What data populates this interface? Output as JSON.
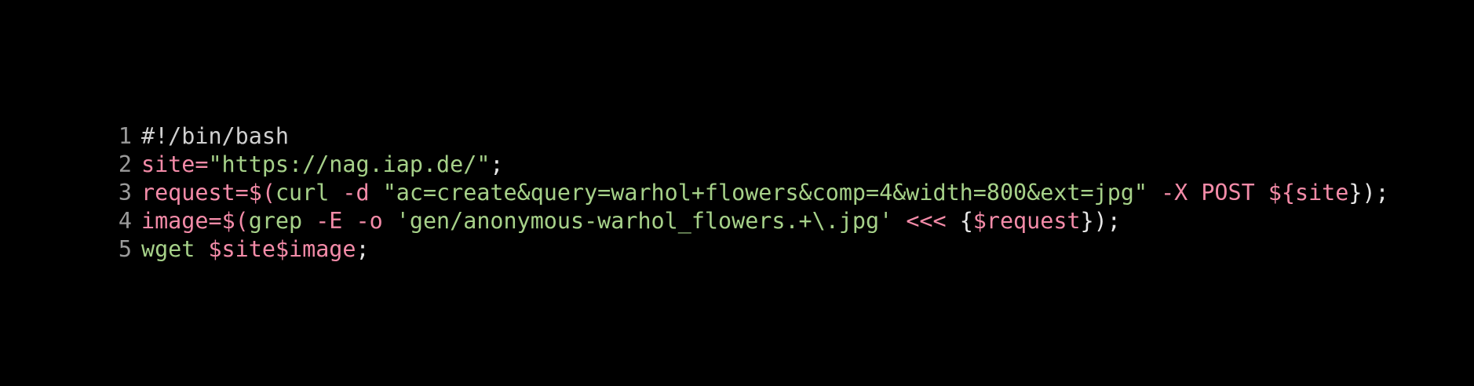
{
  "editor": {
    "language": "bash",
    "colors": {
      "background": "#000000",
      "line_number": "#9a9a9a",
      "default": "#e6e6e6",
      "comment": "#d0d0d0",
      "variable": "#f38ba8",
      "string": "#a6d189",
      "operator": "#f38ba8"
    },
    "lines": [
      {
        "number": "1",
        "tokens": [
          {
            "text": "#!/bin/bash",
            "kind": "comment"
          }
        ]
      },
      {
        "number": "2",
        "tokens": [
          {
            "text": "site",
            "kind": "var"
          },
          {
            "text": "=",
            "kind": "op"
          },
          {
            "text": "\"https://nag.iap.de/\"",
            "kind": "str"
          },
          {
            "text": ";",
            "kind": "punct"
          }
        ]
      },
      {
        "number": "3",
        "tokens": [
          {
            "text": "request",
            "kind": "var"
          },
          {
            "text": "=",
            "kind": "op"
          },
          {
            "text": "$(",
            "kind": "op"
          },
          {
            "text": "curl",
            "kind": "cmd"
          },
          {
            "text": " ",
            "kind": "default"
          },
          {
            "text": "-d",
            "kind": "flag"
          },
          {
            "text": " ",
            "kind": "default"
          },
          {
            "text": "\"ac=create&query=warhol+flowers&comp=4&width=800&ext=jpg\"",
            "kind": "str"
          },
          {
            "text": " ",
            "kind": "default"
          },
          {
            "text": "-X",
            "kind": "flag"
          },
          {
            "text": " ",
            "kind": "default"
          },
          {
            "text": "POST",
            "kind": "flag"
          },
          {
            "text": " ",
            "kind": "default"
          },
          {
            "text": "${",
            "kind": "var"
          },
          {
            "text": "site",
            "kind": "var"
          },
          {
            "text": "}",
            "kind": "punct"
          },
          {
            "text": ");",
            "kind": "punct"
          }
        ]
      },
      {
        "number": "4",
        "tokens": [
          {
            "text": "image",
            "kind": "var"
          },
          {
            "text": "=",
            "kind": "op"
          },
          {
            "text": "$(",
            "kind": "op"
          },
          {
            "text": "grep",
            "kind": "cmd"
          },
          {
            "text": " ",
            "kind": "default"
          },
          {
            "text": "-E",
            "kind": "flag"
          },
          {
            "text": " ",
            "kind": "default"
          },
          {
            "text": "-o",
            "kind": "flag"
          },
          {
            "text": " ",
            "kind": "default"
          },
          {
            "text": "'gen/anonymous-warhol_flowers.+\\.jpg'",
            "kind": "str"
          },
          {
            "text": " ",
            "kind": "default"
          },
          {
            "text": "<<<",
            "kind": "op"
          },
          {
            "text": " ",
            "kind": "default"
          },
          {
            "text": "{",
            "kind": "punct"
          },
          {
            "text": "$request",
            "kind": "var"
          },
          {
            "text": "}",
            "kind": "punct"
          },
          {
            "text": ");",
            "kind": "punct"
          }
        ]
      },
      {
        "number": "5",
        "tokens": [
          {
            "text": "wget",
            "kind": "cmd"
          },
          {
            "text": " ",
            "kind": "default"
          },
          {
            "text": "$site",
            "kind": "var"
          },
          {
            "text": "$image",
            "kind": "var"
          },
          {
            "text": ";",
            "kind": "punct"
          }
        ]
      }
    ]
  }
}
